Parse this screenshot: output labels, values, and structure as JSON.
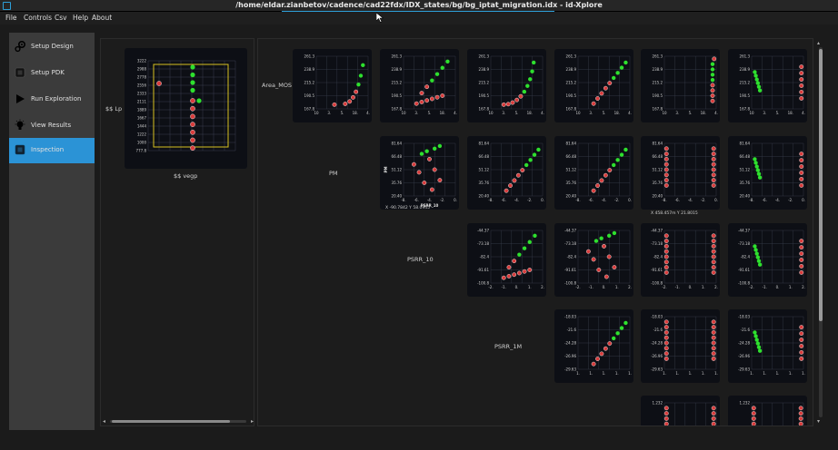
{
  "window": {
    "title": "/home/eldar.zianbetov/cadence/cad22fdx/IDX_states/bg/bg_iptat_migration.idx - id-Xplore"
  },
  "menu": [
    "File",
    "Controls",
    "Csv",
    "Help",
    "About"
  ],
  "sidebar": {
    "items": [
      {
        "label": "Setup Design",
        "icon": "gears-icon",
        "active": false
      },
      {
        "label": "Setup PDK",
        "icon": "chip-icon",
        "active": false
      },
      {
        "label": "Run Exploration",
        "icon": "play-icon",
        "active": false
      },
      {
        "label": "View Results",
        "icon": "lightbulb-icon",
        "active": false
      },
      {
        "label": "Inspection",
        "icon": "chip-icon",
        "active": true
      }
    ]
  },
  "colors": {
    "accent": "#2b93d6",
    "point_red": "#d83c3c",
    "point_green": "#2ee02e",
    "frame_yellow": "#d8c020",
    "plot_bg": "#0d0f15"
  },
  "left_plot": {
    "ylabel": "$$ Lp",
    "xlabel": "$$ vegp",
    "yticks": [
      "3222",
      "2988",
      "2778",
      "2556",
      "2333",
      "2111",
      "1889",
      "1667",
      "1444",
      "1222",
      "1000",
      "777.8"
    ]
  },
  "row_labels": [
    "Area_MOS",
    "PM",
    "PSRR_10",
    "PSRR_1M"
  ],
  "rows": [
    {
      "yticks": [
        "261.3",
        "238.9",
        "215.2",
        "190.5",
        "167.8"
      ],
      "xticks": [
        "10",
        "3.",
        "5.",
        "18.",
        "4."
      ]
    },
    {
      "yticks": [
        "81.64",
        "66.48",
        "51.12",
        "35.76",
        "20.40"
      ],
      "xticks": [
        "-8.",
        "-6.",
        "-4.",
        "-2.",
        "0."
      ]
    },
    {
      "yticks": [
        "-44.37",
        "-73.18",
        "-82.4",
        "-91.61",
        "-100.8"
      ],
      "xticks": [
        "-2.",
        "-1.",
        "0.",
        "1.",
        "2."
      ]
    },
    {
      "yticks": [
        "-18.03",
        "-21.6",
        "-24.28",
        "-26.96",
        "-29.63"
      ],
      "xticks": [
        "1.",
        "1.",
        "1.",
        "1.",
        "1."
      ]
    },
    {
      "yticks": [
        "1.232",
        "1.232"
      ],
      "xticks": []
    }
  ],
  "pm_plot": {
    "xlabel": "PSRR_10",
    "ylabel": "PM",
    "readout": "X -90.7842  Y 58.0945"
  },
  "extra_readout": "X 458.457m  Y 21.8015"
}
